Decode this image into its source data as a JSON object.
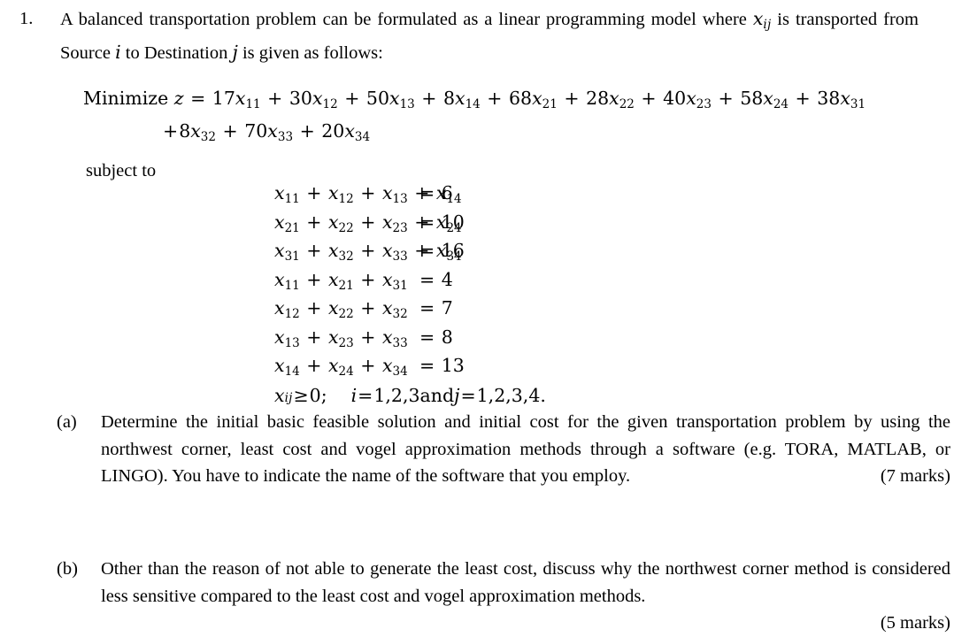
{
  "question": {
    "number": "1.",
    "stem_part1": "A balanced transportation problem can be formulated as a linear programming model where ",
    "stem_var": "x",
    "stem_var_sub": "ij",
    "stem_part2": " is transported from Source ",
    "stem_var_i": "i",
    "stem_part3": " to Destination ",
    "stem_var_j": "j",
    "stem_part4": " is given as follows:"
  },
  "objective": {
    "label": "Minimize ",
    "z": "z",
    "equals": " = ",
    "line1_terms": [
      {
        "coef": "17",
        "var": "x",
        "sub": "11"
      },
      {
        "coef": "30",
        "var": "x",
        "sub": "12"
      },
      {
        "coef": "50",
        "var": "x",
        "sub": "13"
      },
      {
        "coef": "8",
        "var": "x",
        "sub": "14"
      },
      {
        "coef": "68",
        "var": "x",
        "sub": "21"
      },
      {
        "coef": "28",
        "var": "x",
        "sub": "22"
      },
      {
        "coef": "40",
        "var": "x",
        "sub": "23"
      },
      {
        "coef": "58",
        "var": "x",
        "sub": "24"
      },
      {
        "coef": "38",
        "var": "x",
        "sub": "31"
      }
    ],
    "line2_terms": [
      {
        "coef": "8",
        "var": "x",
        "sub": "32"
      },
      {
        "coef": "70",
        "var": "x",
        "sub": "33"
      },
      {
        "coef": "20",
        "var": "x",
        "sub": "34"
      }
    ],
    "plus": "+"
  },
  "subject_to_label": "subject to",
  "constraints": [
    {
      "vars": [
        {
          "var": "x",
          "sub": "11"
        },
        {
          "var": "x",
          "sub": "12"
        },
        {
          "var": "x",
          "sub": "13"
        },
        {
          "var": "x",
          "sub": "14"
        }
      ],
      "rel": "=",
      "rhs": "6"
    },
    {
      "vars": [
        {
          "var": "x",
          "sub": "21"
        },
        {
          "var": "x",
          "sub": "22"
        },
        {
          "var": "x",
          "sub": "23"
        },
        {
          "var": "x",
          "sub": "24"
        }
      ],
      "rel": "=",
      "rhs": "10"
    },
    {
      "vars": [
        {
          "var": "x",
          "sub": "31"
        },
        {
          "var": "x",
          "sub": "32"
        },
        {
          "var": "x",
          "sub": "33"
        },
        {
          "var": "x",
          "sub": "34"
        }
      ],
      "rel": "=",
      "rhs": "16"
    },
    {
      "vars": [
        {
          "var": "x",
          "sub": "11"
        },
        {
          "var": "x",
          "sub": "21"
        },
        {
          "var": "x",
          "sub": "31"
        }
      ],
      "rel": "=",
      "rhs": "4"
    },
    {
      "vars": [
        {
          "var": "x",
          "sub": "12"
        },
        {
          "var": "x",
          "sub": "22"
        },
        {
          "var": "x",
          "sub": "32"
        }
      ],
      "rel": "=",
      "rhs": "7"
    },
    {
      "vars": [
        {
          "var": "x",
          "sub": "13"
        },
        {
          "var": "x",
          "sub": "23"
        },
        {
          "var": "x",
          "sub": "33"
        }
      ],
      "rel": "=",
      "rhs": "8"
    },
    {
      "vars": [
        {
          "var": "x",
          "sub": "14"
        },
        {
          "var": "x",
          "sub": "24"
        },
        {
          "var": "x",
          "sub": "34"
        }
      ],
      "rel": "=",
      "rhs": "13"
    }
  ],
  "nonnegativity": {
    "var": "x",
    "sub": "ij",
    "rel": "≥",
    "rhs": "0;",
    "index_i": "i",
    "i_equals": " = ",
    "i_values": "1,2,3",
    "and": " and ",
    "index_j": "j",
    "j_equals": " = ",
    "j_values": "1,2,3,4."
  },
  "parts": [
    {
      "label": "(a)",
      "text": "Determine the initial basic feasible solution and initial cost for the given transportation problem by using the northwest corner, least cost and vogel approximation methods through a software (e.g. TORA, MATLAB, or LINGO). You have to indicate the name of the software that you employ.",
      "marks": "(7 marks)"
    },
    {
      "label": "(b)",
      "text": "Other than the reason of not able to generate the least cost, discuss why the northwest corner method is considered less sensitive compared to the least cost and vogel approximation methods.",
      "marks": "(5 marks)"
    }
  ],
  "colors": {
    "background": "#ffffff",
    "text": "#000000"
  }
}
